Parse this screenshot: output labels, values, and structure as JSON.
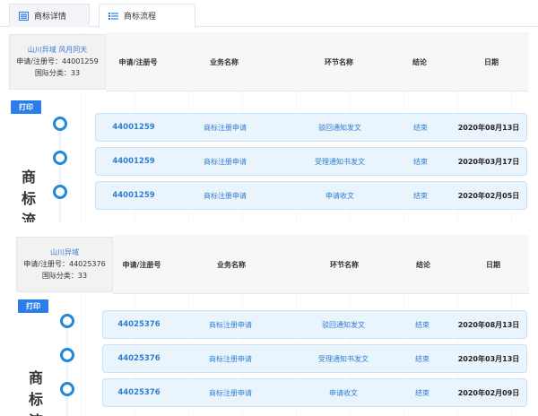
{
  "tabs": [
    {
      "label": "商标详情",
      "icon": "list-icon"
    },
    {
      "label": "商标流程",
      "icon": "flow-list-icon"
    }
  ],
  "columns": [
    "申请/注册号",
    "业务名称",
    "环节名称",
    "结论",
    "日期"
  ],
  "print_label": "打印",
  "sections": [
    {
      "info": {
        "name": "山川异域 风月同天",
        "reg_line": "申请/注册号：44001259",
        "class_line": "国际分类：33"
      },
      "side_title": [
        "商",
        "标",
        "流"
      ],
      "rows": [
        {
          "num": "44001259",
          "business": "商标注册申请",
          "step": "驳回通知发文",
          "result": "结束",
          "date": "2020年08月13日"
        },
        {
          "num": "44001259",
          "business": "商标注册申请",
          "step": "受理通知书发文",
          "result": "结束",
          "date": "2020年03月17日"
        },
        {
          "num": "44001259",
          "business": "商标注册申请",
          "step": "申请收文",
          "result": "结束",
          "date": "2020年02月05日"
        }
      ]
    },
    {
      "info": {
        "name": "山川异域",
        "reg_line": "申请/注册号：44025376",
        "class_line": "国际分类：33"
      },
      "side_title": [
        "商",
        "标",
        "流"
      ],
      "rows": [
        {
          "num": "44025376",
          "business": "商标注册申请",
          "step": "驳回通知发文",
          "result": "结束",
          "date": "2020年08月13日"
        },
        {
          "num": "44025376",
          "business": "商标注册申请",
          "step": "受理通知书发文",
          "result": "结束",
          "date": "2020年03月13日"
        },
        {
          "num": "44025376",
          "business": "商标注册申请",
          "step": "申请收文",
          "result": "结束",
          "date": "2020年02月09日"
        }
      ]
    }
  ]
}
